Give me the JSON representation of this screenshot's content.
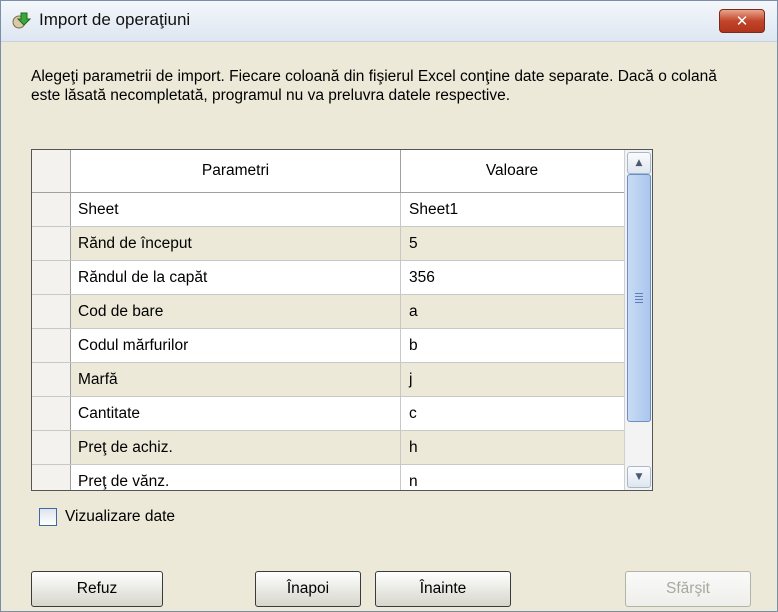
{
  "window": {
    "title": "Import de operaţiuni",
    "icon": "import-icon",
    "close_label": "✕"
  },
  "description": "Alegeţi parametrii de import. Fiecare coloană din fişierul Excel conţine date separate. Dacă o colană este lăsată necompletată, programul nu va preluvra datele respective.",
  "grid": {
    "columns": [
      "Parametri",
      "Valoare"
    ],
    "rows": [
      {
        "param": "Sheet",
        "value": "Sheet1"
      },
      {
        "param": "Rănd de început",
        "value": "5"
      },
      {
        "param": "Răndul de la capăt",
        "value": "356"
      },
      {
        "param": "Cod de bare",
        "value": "a"
      },
      {
        "param": "Codul mărfurilor",
        "value": "b"
      },
      {
        "param": "Marfă",
        "value": "j"
      },
      {
        "param": "Cantitate",
        "value": "c"
      },
      {
        "param": "Preţ de achiz.",
        "value": "h"
      },
      {
        "param": "Preţ de vănz.",
        "value": "n"
      }
    ]
  },
  "checkbox": {
    "label": "Vizualizare date",
    "checked": false
  },
  "buttons": {
    "refuz": "Refuz",
    "inapoi": "Înapoi",
    "inainte": "Înainte",
    "sfarsit": "Sfărşit"
  },
  "colors": {
    "close_red": "#c2452a",
    "alt_row": "#ece9d8",
    "scroll_thumb": "#aac6ee"
  }
}
